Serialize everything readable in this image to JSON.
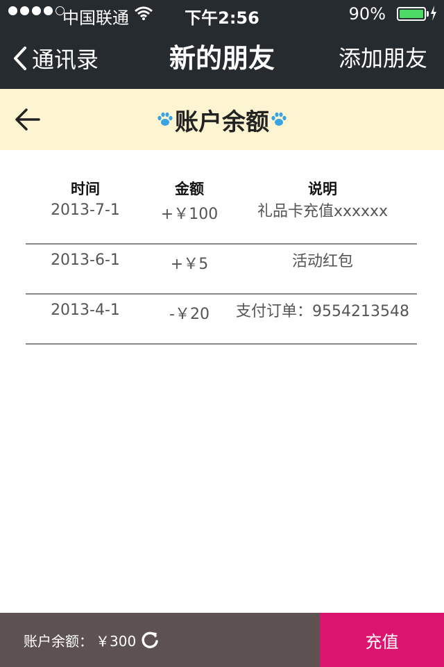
{
  "status_bar": {
    "carrier": "中国联通",
    "time": "下午2:56",
    "battery": "90%",
    "signal_dots": 4
  },
  "nav": {
    "back_label": "通讯录",
    "title": "新的朋友",
    "right_label": "添加朋友"
  },
  "page": {
    "title": "账户余额"
  },
  "table": {
    "headers": [
      "时间",
      "金额",
      "说明"
    ],
    "rows": [
      {
        "date": "2013-7-1",
        "amount": "+￥100",
        "note": "礼品卡充值xxxxxx"
      },
      {
        "date": "2013-6-1",
        "amount": "+￥5",
        "note": "活动红包"
      },
      {
        "date": "2013-4-1",
        "amount": "-￥20",
        "note": "支付订单：9554213548"
      }
    ]
  },
  "footer": {
    "balance_label": "账户余额：",
    "balance_value": "￥300",
    "recharge_label": "充值"
  },
  "colors": {
    "nav_bg": "#262b2f",
    "header_bg": "#fdf5d1",
    "footer_bg": "#5e5151",
    "accent": "#db1470",
    "paw": "#3aa3e3",
    "battery": "#4cd964"
  }
}
